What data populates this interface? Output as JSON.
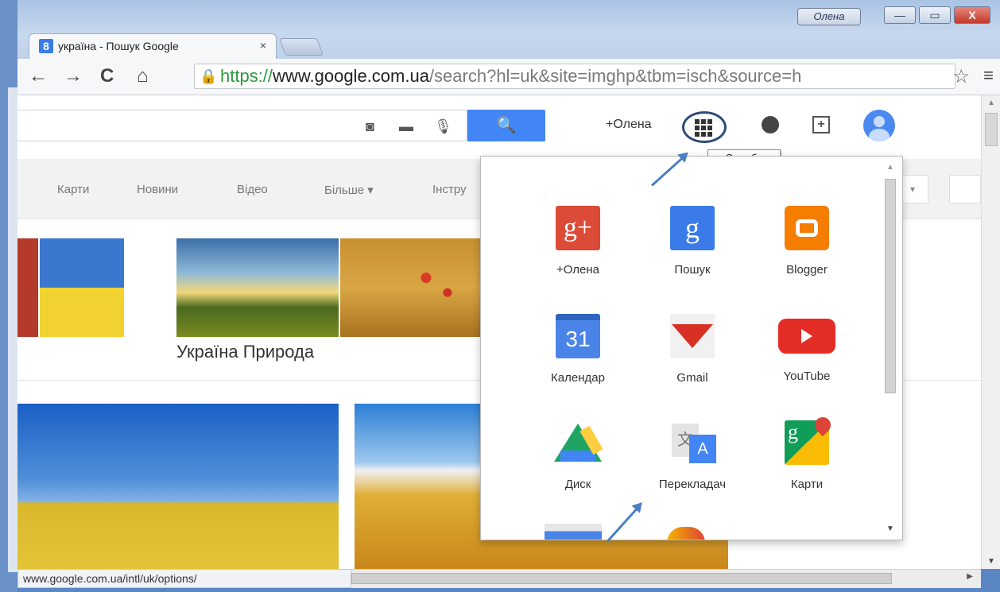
{
  "window": {
    "user_badge": "Олена",
    "minimize": "—",
    "maximize": "▭",
    "close": "X"
  },
  "tab": {
    "favicon": "8",
    "title": "україна - Пошук Google",
    "close": "×"
  },
  "toolbar": {
    "back_icon": "←",
    "forward_icon": "→",
    "reload_icon": "C",
    "home_icon": "⌂",
    "url_scheme": "https://",
    "url_host": "www.google.com.ua",
    "url_path": "/search?hl=uk&site=imghp&tbm=isch&source=h",
    "star_icon": "☆",
    "menu_icon": "≡"
  },
  "header": {
    "camera_icon": "◙",
    "keyboard_icon": "▬",
    "mic_icon": "🎙",
    "search_icon": "🔍",
    "plus_user": "+Олена",
    "tooltip": "Служби"
  },
  "search_tabs": [
    "Карти",
    "Новини",
    "Відео",
    "Більше ▾",
    "Інстру"
  ],
  "results": {
    "caption": "Україна Природа"
  },
  "apps": [
    {
      "label": "+Олена",
      "glyph": "g+",
      "icon": "google-plus-icon"
    },
    {
      "label": "Пошук",
      "glyph": "g",
      "icon": "google-search-icon"
    },
    {
      "label": "Blogger",
      "glyph": "",
      "icon": "blogger-icon"
    },
    {
      "label": "Календар",
      "glyph": "31",
      "icon": "calendar-icon"
    },
    {
      "label": "Gmail",
      "glyph": "",
      "icon": "gmail-icon"
    },
    {
      "label": "YouTube",
      "glyph": "",
      "icon": "youtube-icon"
    },
    {
      "label": "Диск",
      "glyph": "",
      "icon": "drive-icon"
    },
    {
      "label": "Перекладач",
      "glyph": "A",
      "icon": "translate-icon"
    },
    {
      "label": "Карти",
      "glyph": "g",
      "icon": "maps-icon"
    }
  ],
  "status_bar": {
    "url": "www.google.com.ua/intl/uk/options/"
  },
  "colors": {
    "accent_blue": "#4285f4",
    "arrow": "#4a7fc4"
  }
}
